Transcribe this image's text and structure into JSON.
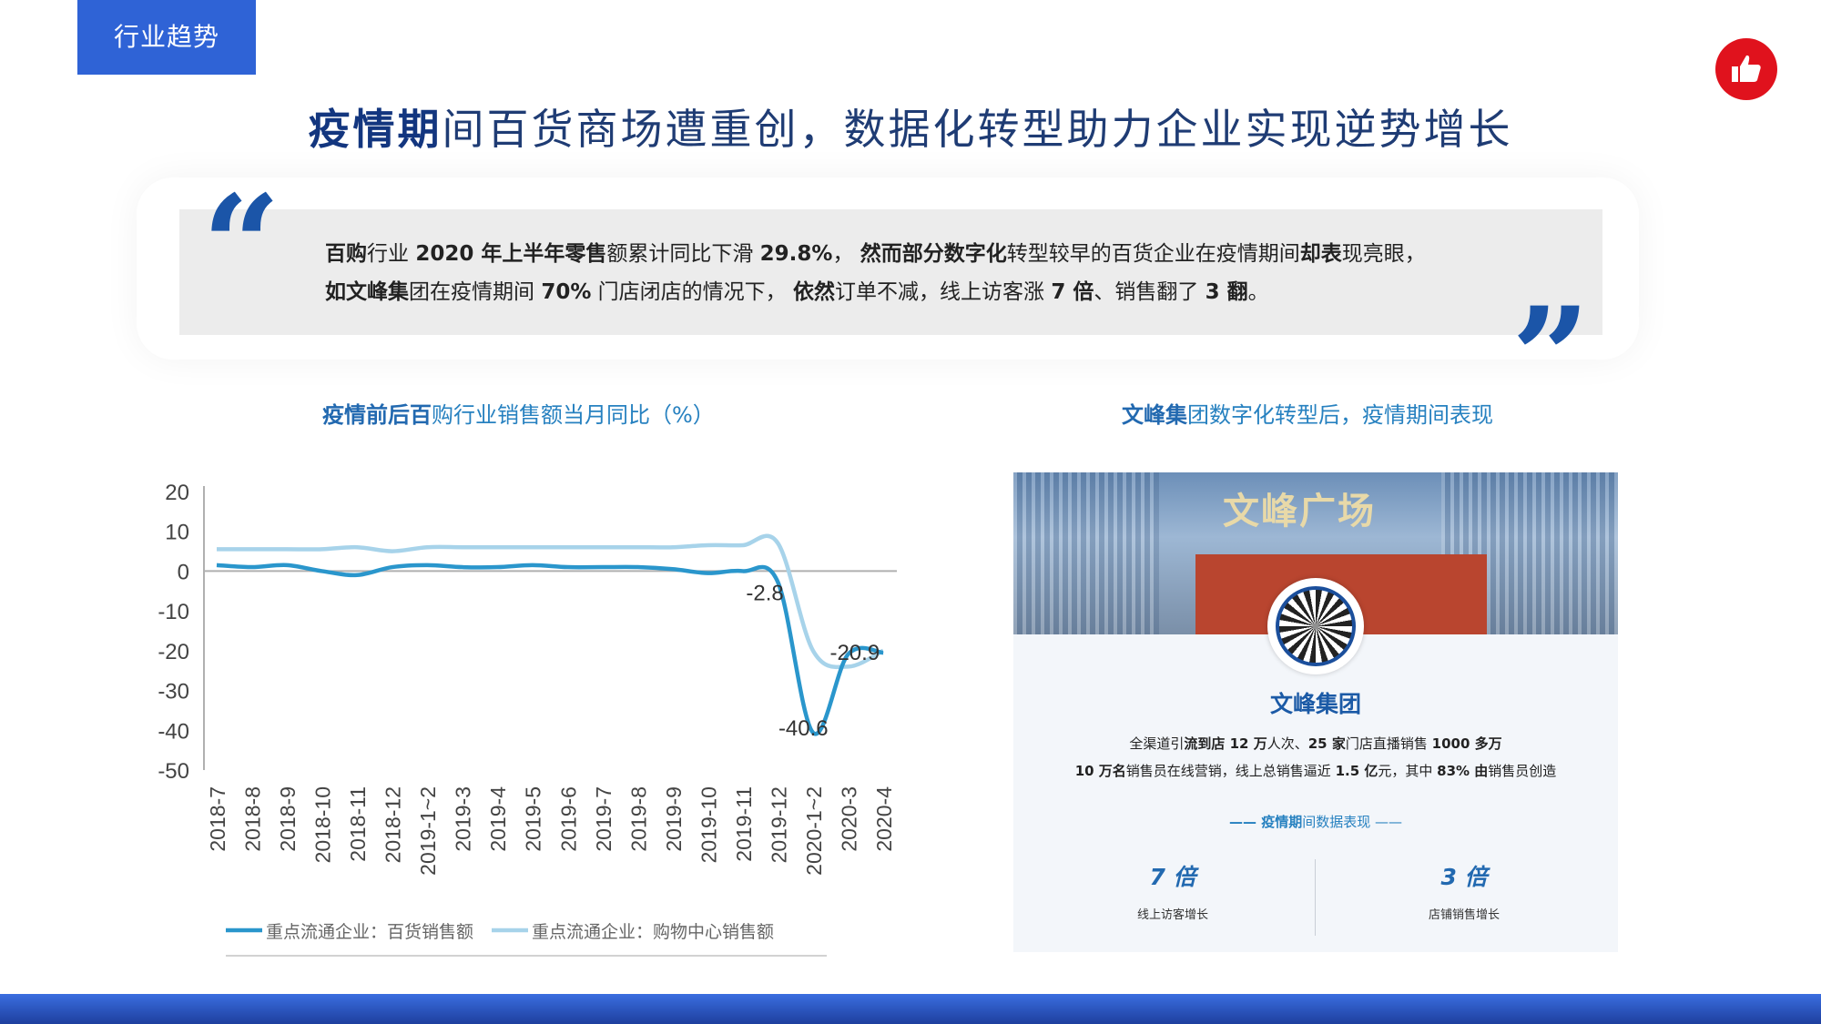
{
  "header": {
    "tag": "行业趋势",
    "title_bold": "疫情期",
    "title_rest": "间百货商场遭重创，数据化转型助力企业实现逆势增长"
  },
  "quote": {
    "line1": [
      "百购",
      "行业 ",
      "2020 年上半年零售",
      "额累计同比下滑 ",
      "29.8%",
      "， ",
      "然而部分数字化",
      "转型较早的百货企业在疫情期间",
      "却表",
      "现亮眼，"
    ],
    "line2": [
      "如文峰集",
      "团在疫情期间 ",
      "70%",
      " 门店闭店的情况下， ",
      "依然",
      "订单不减，线上访客涨 ",
      "7 倍",
      "、销售翻了 ",
      "3 翻",
      "。"
    ]
  },
  "left_section": {
    "subtitle_bold": "疫情前后百",
    "subtitle_rest": "购行业销售额当月同比（%）"
  },
  "right_section": {
    "subtitle_bold": "文峰集",
    "subtitle_rest": "团数字化转型后，疫情期间表现"
  },
  "card": {
    "photo_sign": "文峰广场",
    "company": "文峰集团",
    "line1": [
      "全渠道引",
      "流到店 ",
      "12 万",
      "人次、",
      "25 家",
      "门店直播销售 ",
      "1000 多万"
    ],
    "line2": [
      "10 万名",
      "销售员在线营销，线上总销售逼近 ",
      "1.5 亿",
      "元，其中 ",
      "83% 由",
      "销售员创造"
    ],
    "section_bold": "—— 疫情期",
    "section_rest": "间数据表现 ——",
    "stats": [
      {
        "value": "7 倍",
        "label": "线上访客增长"
      },
      {
        "value": "3 倍",
        "label": "店铺销售增长"
      }
    ]
  },
  "colors": {
    "accent": "#2f63d6",
    "series_dark": "#2a96cc",
    "series_light": "#a7d3ea",
    "thumb": "#e0121d"
  },
  "chart_data": {
    "type": "line",
    "categories": [
      "2018-7",
      "2018-8",
      "2018-9",
      "2018-10",
      "2018-11",
      "2018-12",
      "2019-1~2",
      "2019-3",
      "2019-4",
      "2019-5",
      "2019-6",
      "2019-7",
      "2019-8",
      "2019-9",
      "2019-10",
      "2019-11",
      "2019-12",
      "2020-1~2",
      "2020-3",
      "2020-4"
    ],
    "ylim": [
      -50,
      20
    ],
    "yticks": [
      20,
      10,
      0,
      -10,
      -20,
      -30,
      -40,
      -50
    ],
    "series": [
      {
        "name": "重点流通企业：百货销售额",
        "color": "#2a96cc",
        "values": [
          1.5,
          1.0,
          1.5,
          0.0,
          -1.0,
          1.0,
          1.5,
          1.0,
          1.0,
          1.5,
          1.0,
          1.0,
          1.0,
          0.5,
          -0.5,
          0.0,
          -2.8,
          -40.6,
          -20.9,
          -20.5
        ]
      },
      {
        "name": "重点流通企业：购物中心销售额",
        "color": "#a7d3ea",
        "values": [
          5.5,
          5.5,
          5.5,
          5.5,
          6.0,
          5.0,
          6.0,
          6.0,
          6.0,
          6.0,
          6.0,
          6.0,
          6.0,
          6.0,
          6.5,
          6.5,
          7.0,
          -20.0,
          -24.0,
          -20.0
        ]
      }
    ],
    "annotations": [
      {
        "text": "-2.8",
        "x": "2019-12",
        "y": -2.8
      },
      {
        "text": "-20.9",
        "x": "2020-3",
        "y": -20.9
      },
      {
        "text": "-40.6",
        "x": "2020-1~2",
        "y": -40.6
      }
    ],
    "legend_position": "bottom",
    "grid": false
  }
}
